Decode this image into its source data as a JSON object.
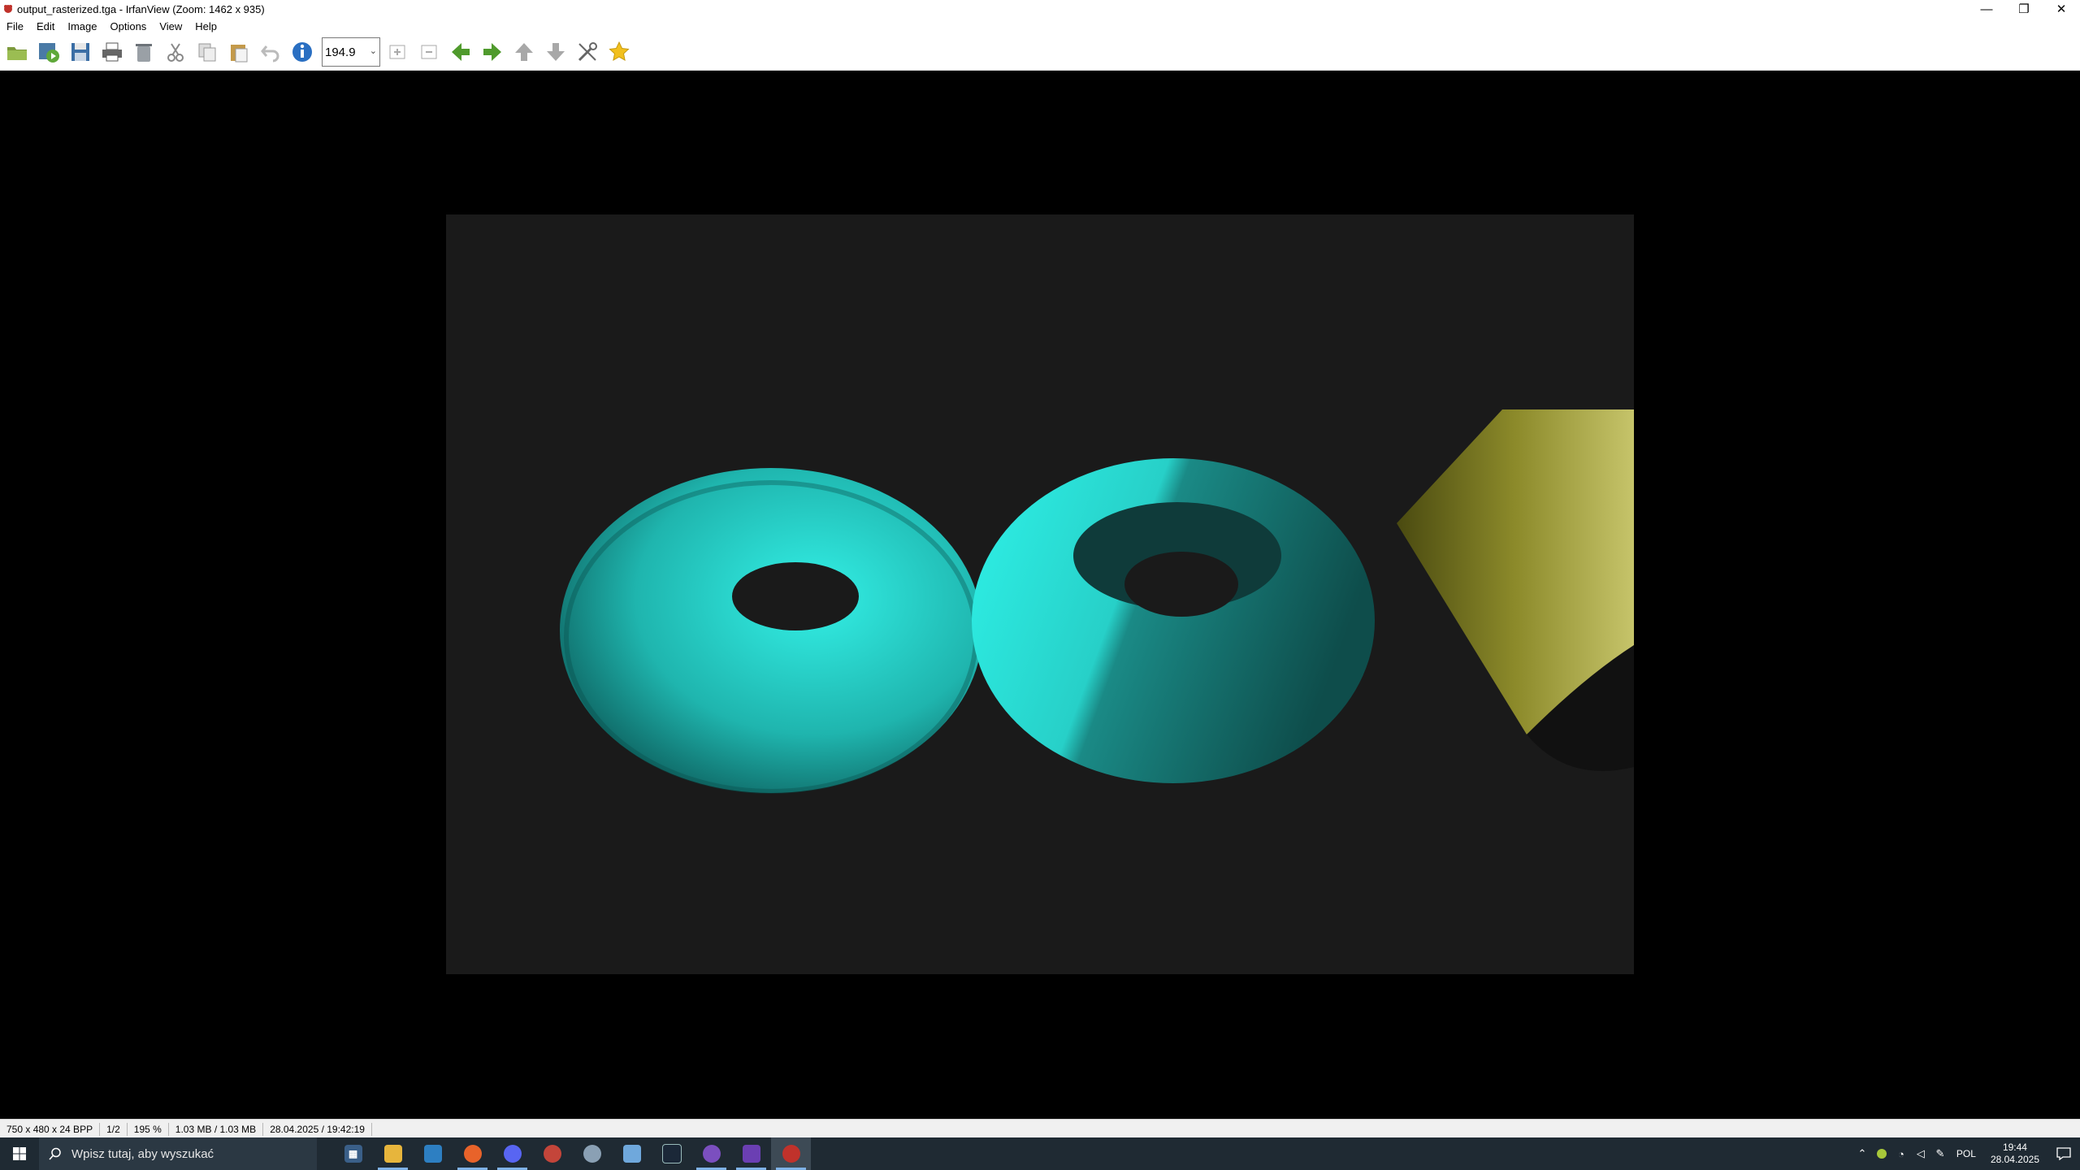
{
  "window": {
    "title": "output_rasterized.tga - IrfanView (Zoom: 1462 x 935)",
    "minimize": "—",
    "restore": "❐",
    "close": "✕"
  },
  "menu": [
    "File",
    "Edit",
    "Image",
    "Options",
    "View",
    "Help"
  ],
  "toolbar": {
    "zoom_value": "194.9",
    "icons": [
      "open-folder-icon",
      "slideshow-icon",
      "save-icon",
      "print-icon",
      "delete-icon",
      "cut-icon",
      "copy-icon",
      "paste-icon",
      "undo-icon",
      "info-icon",
      "zoom-in-icon",
      "zoom-out-icon",
      "previous-icon",
      "next-icon",
      "upload-icon",
      "download-icon",
      "settings-icon",
      "favorite-icon"
    ]
  },
  "statusbar": {
    "resolution": "750 x 480 x 24 BPP",
    "index": "1/2",
    "zoom": "195 %",
    "size": "1.03 MB / 1.03 MB",
    "datetime": "28.04.2025 / 19:42:19"
  },
  "taskbar": {
    "search_placeholder": "Wpisz tutaj, aby wyszukać",
    "apps": [
      "calculator-icon",
      "file-explorer-icon",
      "app-icon",
      "firefox-icon",
      "discord-icon",
      "app-icon",
      "app-icon",
      "app-icon",
      "steam-icon",
      "github-icon",
      "visual-studio-icon",
      "irfanview-icon"
    ],
    "tray_lang": "POL",
    "time": "19:44",
    "date": "28.04.2025"
  },
  "colors": {
    "background": "#000000",
    "image_background": "#1a1a1a",
    "torus": "#2bd3cc",
    "cylinder": "#8a8a2a"
  }
}
